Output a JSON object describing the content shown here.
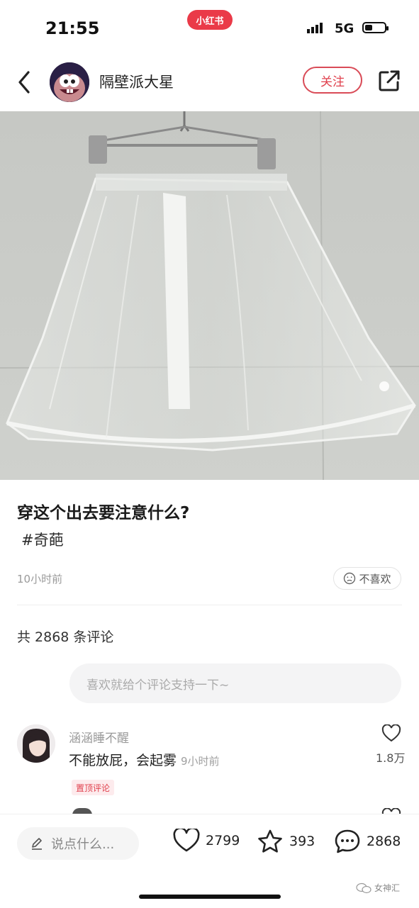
{
  "status_bar": {
    "time": "21:55",
    "brand": "小红书",
    "network": "5G",
    "battery_level": 0.4
  },
  "header": {
    "author": "隔壁派大星",
    "follow_label": "关注"
  },
  "post": {
    "title": "穿这个出去要注意什么?",
    "tag": "#奇葩",
    "time_ago": "10小时前",
    "dislike_label": "不喜欢"
  },
  "comments": {
    "count_text": "共 2868 条评论",
    "input_placeholder": "喜欢就给个评论支持一下~",
    "items": [
      {
        "user": "涵涵睡不醒",
        "text": "不能放屁，会起雾",
        "time": "9小时前",
        "badge": "置顶评论",
        "likes": "1.8万"
      }
    ]
  },
  "bottom_bar": {
    "say_placeholder": "说点什么...",
    "likes": "2799",
    "favorites": "393",
    "comments": "2868"
  },
  "watermark": "女神汇",
  "icons": [
    "back-icon",
    "share-icon",
    "dislike-face-icon",
    "heart-icon",
    "star-icon",
    "comment-bubble-icon",
    "pencil-icon",
    "wechat-icon"
  ],
  "colors": {
    "accent": "#e0404d",
    "brand": "#ea3a48"
  }
}
